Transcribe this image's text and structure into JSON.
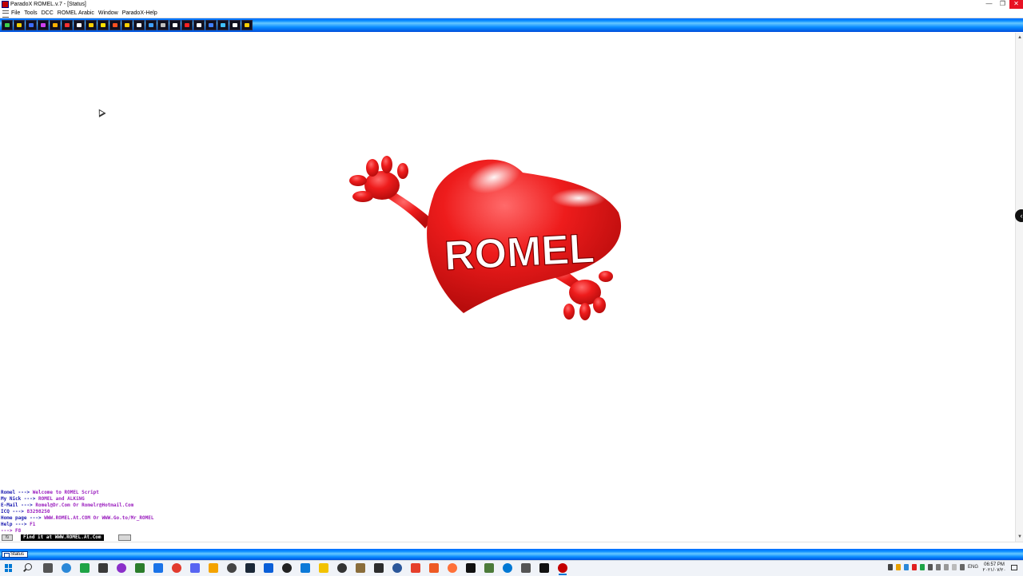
{
  "window": {
    "title": "ParadoX ROMEL.v.7 - [Status]",
    "controls": [
      "—",
      "❐",
      "✕"
    ]
  },
  "menu": {
    "items": [
      "File",
      "Tools",
      "DCC",
      "ROMEL Arabic",
      "Window",
      "ParadoX-Help"
    ]
  },
  "toolbar": {
    "button_colors": [
      "#3cd24a",
      "#f0d000",
      "#3c6cff",
      "#d040f0",
      "#ffb000",
      "#ff3030",
      "#ffffff",
      "#ffd000",
      "#ffe000",
      "#ff5020",
      "#ffd000",
      "#ffffff",
      "#40a0ff",
      "#c0c0c0",
      "#ffffff",
      "#ff2020",
      "#ffffff",
      "#4080ff",
      "#40c0ff",
      "#ffffff",
      "#ffd000"
    ]
  },
  "logo": {
    "text": "ROMEL",
    "color": "#e81818"
  },
  "status_lines": [
    {
      "label": "Romel --->",
      "value": "Welcome to ROMEL Script"
    },
    {
      "label": "My Nick --->",
      "value": "ROMEL and ALKiNG"
    },
    {
      "label": "E-Mail --->",
      "value": "Romel@Dr.Com Or Romelr@Hotmail.Com"
    },
    {
      "label": "ICQ --->",
      "value": "83298250"
    },
    {
      "label": "Home page --->",
      "value": "WWW.ROMEL.At.COM Or WWW.Go.to/Mr_ROMEL"
    },
    {
      "label": "Help --->",
      "value": "F1"
    },
    {
      "label": "",
      "value": "---> F8"
    }
  ],
  "input_bar": {
    "text": "Find it at WWW.ROMEL.At.Com"
  },
  "switchbar": {
    "tab_label": "Status"
  },
  "taskbar": {
    "app_colors": [
      "#555555",
      "#2b88d8",
      "#1ea446",
      "#3a3a3a",
      "#8b2fc9",
      "#2b7d2b",
      "#1a73e8",
      "#e23b2e",
      "#5865f2",
      "#f4a300",
      "#444444",
      "#1b2838",
      "#0a5fd8",
      "#222222",
      "#0c7ad8",
      "#f2c200",
      "#333333",
      "#8a6d3b",
      "#2d2d2d",
      "#2b579a",
      "#e6402c",
      "#ee5a24",
      "#ff7139",
      "#111111",
      "#4c7b3a",
      "#0078d4",
      "#555555",
      "#111111",
      "#c40000"
    ],
    "tray_colors": [
      "#444",
      "#e8a000",
      "#2b88d8",
      "#e02020",
      "#1ea446",
      "#555",
      "#777",
      "#999",
      "#bbb",
      "#666"
    ],
    "language": "ENG",
    "time": "06:57 PM",
    "date": "٢٠٢١/٠٧/٢٠"
  }
}
